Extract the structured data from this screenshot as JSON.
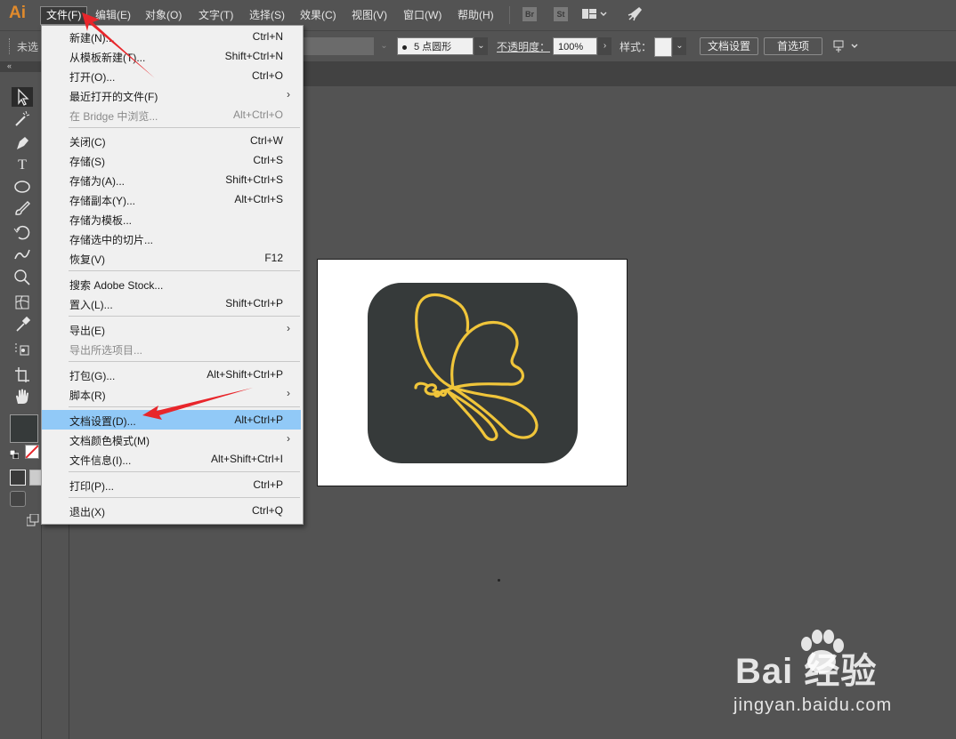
{
  "app": {
    "logo": "Ai"
  },
  "menubar": {
    "items": [
      "文件(F)",
      "编辑(E)",
      "对象(O)",
      "文字(T)",
      "选择(S)",
      "效果(C)",
      "视图(V)",
      "窗口(W)",
      "帮助(H)"
    ],
    "bridge_icon": "Br",
    "stock_icon": "St"
  },
  "controlbar": {
    "no_selection": "未选",
    "brush_label": "5 点圆形",
    "opacity_label": "不透明度：",
    "opacity_value": "100%",
    "style_label": "样式：",
    "doc_setup_button": "文档设置",
    "prefs_button": "首选项"
  },
  "file_menu": {
    "items": [
      {
        "label": "新建(N)...",
        "shortcut": "Ctrl+N"
      },
      {
        "label": "从模板新建(T)...",
        "shortcut": "Shift+Ctrl+N"
      },
      {
        "label": "打开(O)...",
        "shortcut": "Ctrl+O"
      },
      {
        "label": "最近打开的文件(F)",
        "shortcut": "",
        "submenu": true
      },
      {
        "label": "在 Bridge 中浏览...",
        "shortcut": "Alt+Ctrl+O",
        "disabled": true
      },
      {
        "label": "关闭(C)",
        "shortcut": "Ctrl+W"
      },
      {
        "label": "存储(S)",
        "shortcut": "Ctrl+S"
      },
      {
        "label": "存储为(A)...",
        "shortcut": "Shift+Ctrl+S"
      },
      {
        "label": "存储副本(Y)...",
        "shortcut": "Alt+Ctrl+S"
      },
      {
        "label": "存储为模板...",
        "shortcut": ""
      },
      {
        "label": "存储选中的切片...",
        "shortcut": ""
      },
      {
        "label": "恢复(V)",
        "shortcut": "F12"
      },
      {
        "label": "搜索 Adobe Stock...",
        "shortcut": ""
      },
      {
        "label": "置入(L)...",
        "shortcut": "Shift+Ctrl+P"
      },
      {
        "label": "导出(E)",
        "shortcut": "",
        "submenu": true
      },
      {
        "label": "导出所选项目...",
        "shortcut": "",
        "disabled": true
      },
      {
        "label": "打包(G)...",
        "shortcut": "Alt+Shift+Ctrl+P"
      },
      {
        "label": "脚本(R)",
        "shortcut": "",
        "submenu": true
      },
      {
        "label": "文档设置(D)...",
        "shortcut": "Alt+Ctrl+P",
        "highlighted": true
      },
      {
        "label": "文档颜色模式(M)",
        "shortcut": "",
        "submenu": true
      },
      {
        "label": "文件信息(I)...",
        "shortcut": "Alt+Shift+Ctrl+I"
      },
      {
        "label": "打印(P)...",
        "shortcut": "Ctrl+P"
      },
      {
        "label": "退出(X)",
        "shortcut": "Ctrl+Q"
      }
    ]
  },
  "artwork": {
    "background_color": "#363a3a",
    "stroke_color": "#f0c53a"
  },
  "watermark": {
    "brand": "Bai 经验",
    "url": "jingyan.baidu.com"
  },
  "colors": {
    "highlight": "#91c9f7",
    "annotation_arrow": "#e8262b"
  }
}
